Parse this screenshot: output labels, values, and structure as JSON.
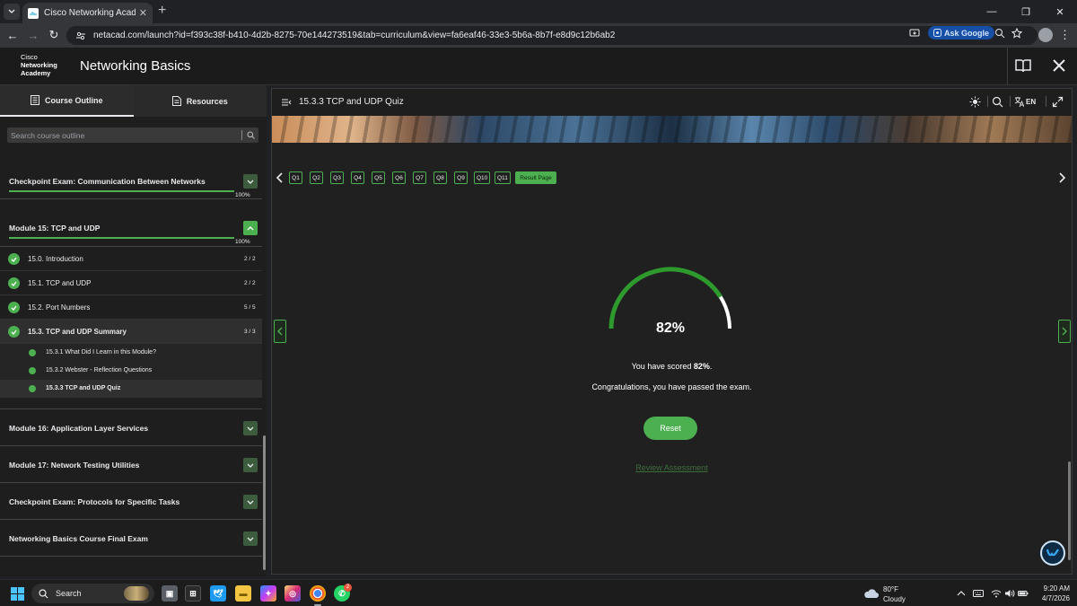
{
  "browser": {
    "tab_title": "Cisco Networking Academy: Ne",
    "url": "netacad.com/launch?id=f393c38f-b410-4d2b-8275-70e144273519&tab=curriculum&view=fa6eaf46-33e3-5b6a-8b7f-e8d9c12b6ab2",
    "ask_google": "Ask Google"
  },
  "header": {
    "logo_line1": "Cisco",
    "logo_line2": "Networking",
    "logo_line3": "Academy",
    "title": "Networking Basics"
  },
  "sidebar": {
    "tabs": [
      "Course Outline",
      "Resources"
    ],
    "search_placeholder": "Search course outline",
    "checkpoint_comm": {
      "title": "Checkpoint Exam: Communication Between Networks",
      "pct": "100%"
    },
    "module15": {
      "title": "Module 15: TCP and UDP",
      "pct": "100%"
    },
    "lessons": [
      {
        "title": "15.0. Introduction",
        "count": "2 / 2"
      },
      {
        "title": "15.1. TCP and UDP",
        "count": "2 / 2"
      },
      {
        "title": "15.2. Port Numbers",
        "count": "5 / 5"
      },
      {
        "title": "15.3. TCP and UDP Summary",
        "count": "3 / 3"
      }
    ],
    "sublessons": [
      "15.3.1 What Did I Learn in this Module?",
      "15.3.2 Webster - Reflection Questions",
      "15.3.3 TCP and UDP Quiz"
    ],
    "modules_after": [
      "Module 16: Application Layer Services",
      "Module 17: Network Testing Utilities",
      "Checkpoint Exam: Protocols for Specific Tasks",
      "Networking Basics Course Final Exam"
    ]
  },
  "main": {
    "title": "15.3.3 TCP and UDP Quiz",
    "lang": "EN",
    "questions": [
      "Q1",
      "Q2",
      "Q3",
      "Q4",
      "Q5",
      "Q6",
      "Q7",
      "Q8",
      "Q9",
      "Q10",
      "Q11"
    ],
    "result_page": "Result Page",
    "score_pct": "82%",
    "score_fraction": 0.82,
    "score_prefix": "You have scored ",
    "score_value": "82%",
    "score_suffix": ".",
    "pass_message": "Congratulations, you have passed the exam.",
    "reset_label": "Reset",
    "review_label": "Review Assessment",
    "accent": "#4caf50"
  },
  "taskbar": {
    "search_label": "Search",
    "chrome_badge": "2",
    "weather_temp": "80°F",
    "weather_cond": "Cloudy",
    "time": "9:20 AM",
    "date": "4/7/2026"
  }
}
